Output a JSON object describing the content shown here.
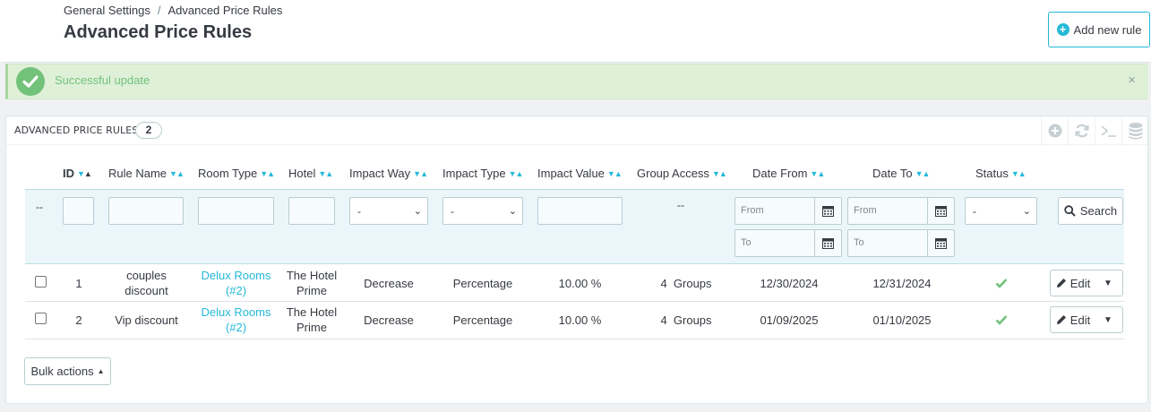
{
  "breadcrumb": {
    "parent": "General Settings",
    "separator": "/",
    "current": "Advanced Price Rules"
  },
  "page_title": "Advanced Price Rules",
  "add_button_label": "Add new rule",
  "alert": {
    "message": "Successful update",
    "close": "×"
  },
  "panel": {
    "title": "ADVANCED PRICE RULES",
    "count": "2"
  },
  "columns": {
    "id": "ID",
    "rule_name": "Rule Name",
    "room_type": "Room Type",
    "hotel": "Hotel",
    "impact_way": "Impact Way",
    "impact_type": "Impact Type",
    "impact_value": "Impact Value",
    "group_access": "Group Access",
    "date_from": "Date From",
    "date_to": "Date To",
    "status": "Status"
  },
  "filters": {
    "checkbox_col": "--",
    "group_access": "--",
    "impact_way_selected": "-",
    "impact_type_selected": "-",
    "status_selected": "-",
    "from_placeholder": "From",
    "to_placeholder": "To",
    "search_label": "Search"
  },
  "rows": [
    {
      "id": "1",
      "rule_name_line1": "couples",
      "rule_name_line2": "discount",
      "room_type_line1": "Delux Rooms",
      "room_type_line2": "(#2)",
      "hotel_line1": "The Hotel",
      "hotel_line2": "Prime",
      "impact_way": "Decrease",
      "impact_type": "Percentage",
      "impact_value": "10.00 %",
      "group_access": "4  Groups",
      "date_from": "12/30/2024",
      "date_to": "12/31/2024",
      "status": "enabled",
      "edit_label": "Edit"
    },
    {
      "id": "2",
      "rule_name_line1": "Vip discount",
      "rule_name_line2": "",
      "room_type_line1": "Delux Rooms",
      "room_type_line2": "(#2)",
      "hotel_line1": "The Hotel",
      "hotel_line2": "Prime",
      "impact_way": "Decrease",
      "impact_type": "Percentage",
      "impact_value": "10.00 %",
      "group_access": "4  Groups",
      "date_from": "01/09/2025",
      "date_to": "01/10/2025",
      "status": "enabled",
      "edit_label": "Edit"
    }
  ],
  "bulk_actions_label": "Bulk actions",
  "colors": {
    "accent": "#25b9d7",
    "success": "#72c279",
    "alert_bg": "#dff0d8",
    "filter_bg": "#eaf6fa"
  },
  "icons": [
    "check-circle-icon",
    "close-icon",
    "plus-circle-icon",
    "refresh-icon",
    "terminal-icon",
    "database-icon",
    "calendar-icon",
    "search-icon",
    "pencil-icon",
    "caret-down-icon",
    "caret-up-icon",
    "checkmark-icon",
    "sort-icon"
  ]
}
